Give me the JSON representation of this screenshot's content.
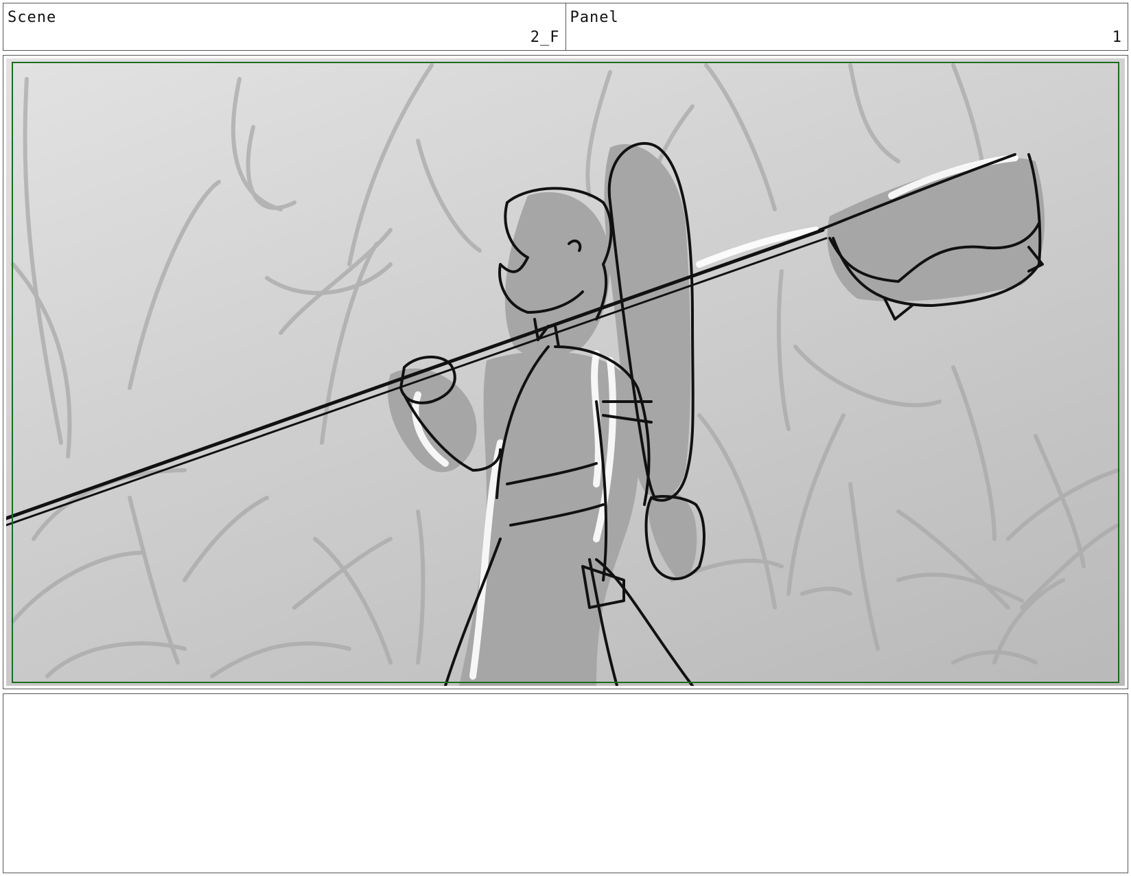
{
  "header": {
    "scene_label": "Scene",
    "scene_value": "2_F",
    "panel_label": "Panel",
    "panel_value": "1"
  },
  "notes": {
    "text": ""
  },
  "colors": {
    "safe_area_border": "#1e6b1e",
    "ink": "#111111",
    "fill": "#a6a6a6",
    "background_light": "#e2e2e2",
    "background_dark": "#b9b9b9"
  }
}
